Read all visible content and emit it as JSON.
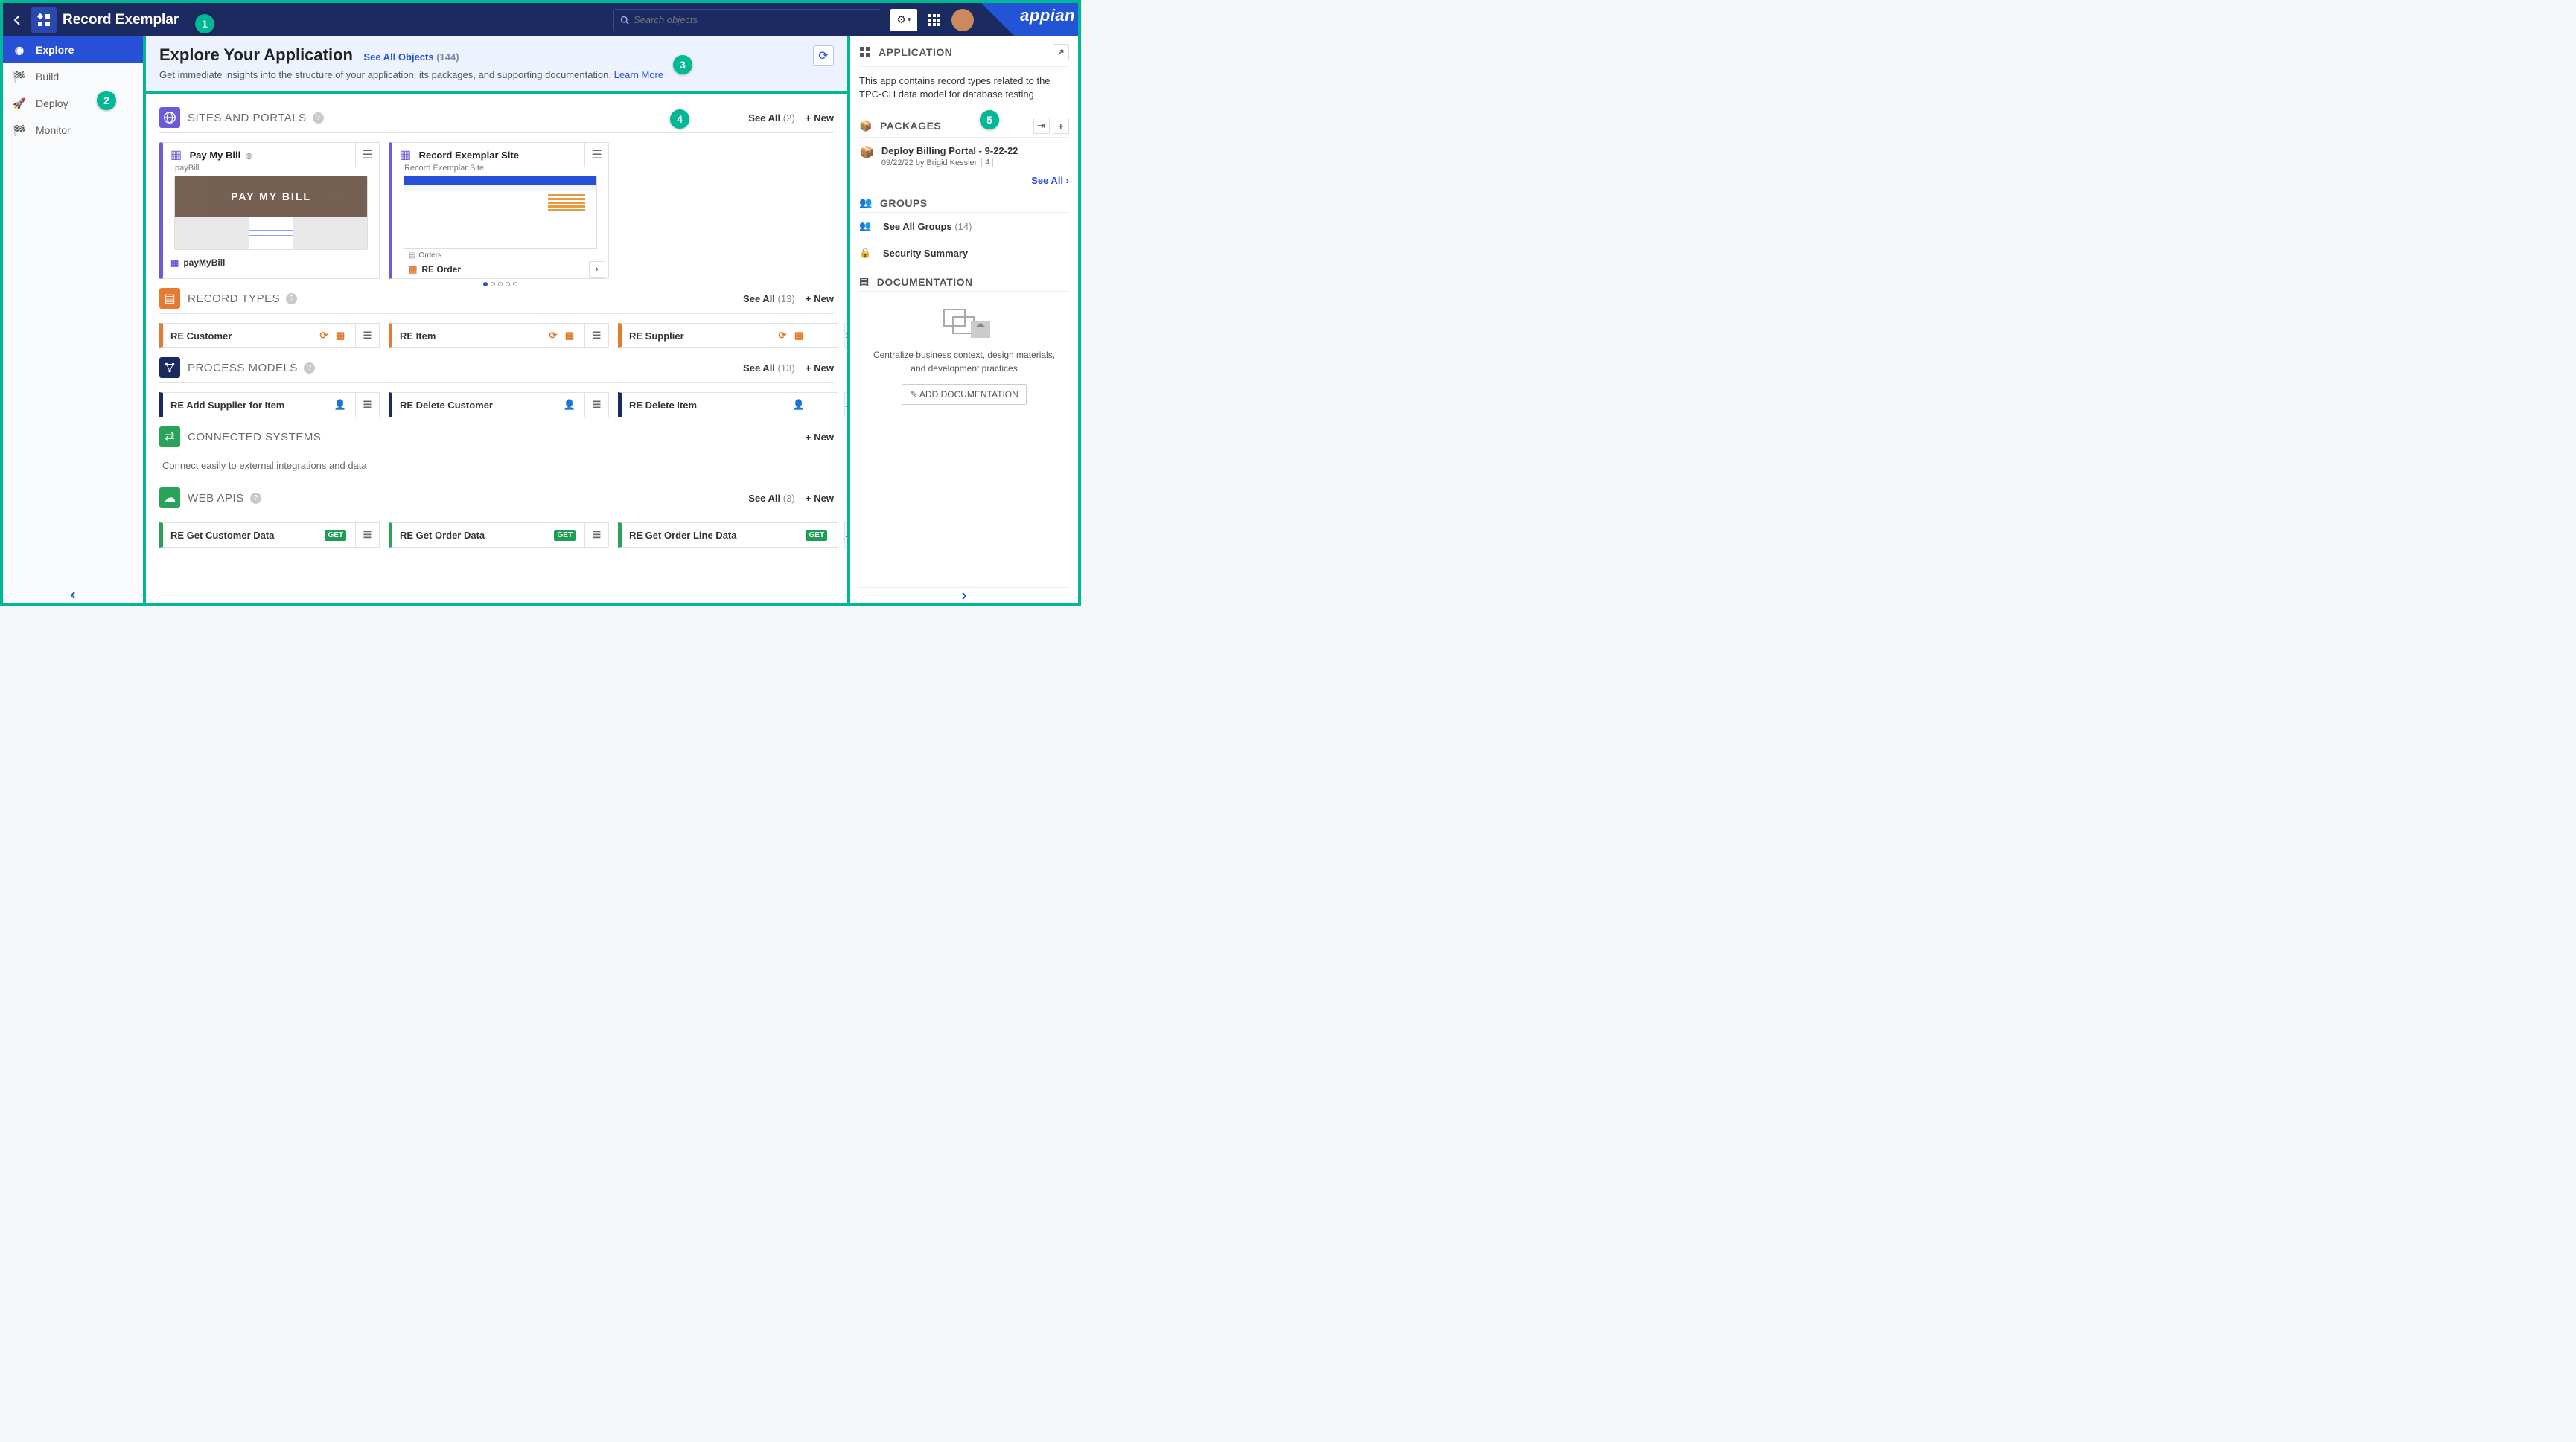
{
  "topbar": {
    "app_title": "Record Exemplar",
    "search_placeholder": "Search objects",
    "brand": "appian"
  },
  "sidebar": {
    "items": [
      {
        "label": "Explore"
      },
      {
        "label": "Build"
      },
      {
        "label": "Deploy"
      },
      {
        "label": "Monitor"
      }
    ]
  },
  "main": {
    "title": "Explore Your Application",
    "see_all_label": "See All Objects",
    "see_all_count": "(144)",
    "subtitle": "Get immediate insights into the structure of your application, its packages, and supporting documentation.",
    "learn_more": "Learn More"
  },
  "sections": {
    "sites": {
      "title": "SITES AND PORTALS",
      "see_all": "See All",
      "see_all_count": "(2)",
      "new_label": "New",
      "cards": [
        {
          "title": "Pay My Bill",
          "subtitle": "payBill",
          "hero": "PAY MY BILL",
          "page_name": "payMyBill"
        },
        {
          "title": "Record Exemplar Site",
          "subtitle": "Record Exemplar Site",
          "tab_group": "Orders",
          "tab_active": "RE Order"
        }
      ]
    },
    "record_types": {
      "title": "RECORD TYPES",
      "see_all": "See All",
      "see_all_count": "(13)",
      "new_label": "New",
      "items": [
        {
          "name": "RE Customer"
        },
        {
          "name": "RE Item"
        },
        {
          "name": "RE Supplier"
        }
      ]
    },
    "process_models": {
      "title": "PROCESS MODELS",
      "see_all": "See All",
      "see_all_count": "(13)",
      "new_label": "New",
      "items": [
        {
          "name": "RE Add Supplier for Item"
        },
        {
          "name": "RE Delete Customer"
        },
        {
          "name": "RE Delete Item"
        }
      ]
    },
    "connected_systems": {
      "title": "CONNECTED SYSTEMS",
      "new_label": "New",
      "empty_text": "Connect easily to external integrations and data"
    },
    "web_apis": {
      "title": "WEB APIS",
      "see_all": "See All",
      "see_all_count": "(3)",
      "new_label": "New",
      "items": [
        {
          "name": "RE Get Customer Data",
          "method": "GET"
        },
        {
          "name": "RE Get Order Data",
          "method": "GET"
        },
        {
          "name": "RE Get Order Line Data",
          "method": "GET"
        }
      ]
    }
  },
  "rightpanel": {
    "app_head": "APPLICATION",
    "description": "This app contains record types related to the TPC-CH data model for database testing",
    "packages_head": "PACKAGES",
    "package": {
      "title": "Deploy Billing Portal - 9-22-22",
      "meta": "09/22/22 by Brigid Kessler",
      "count": "4"
    },
    "see_all": "See All",
    "groups_head": "GROUPS",
    "groups_link": "See All Groups",
    "groups_count": "(14)",
    "security_link": "Security Summary",
    "docs_head": "DOCUMENTATION",
    "docs_text": "Centralize business context, design materials, and development practices",
    "docs_btn": "ADD DOCUMENTATION"
  },
  "callouts": [
    "1",
    "2",
    "3",
    "4",
    "5"
  ],
  "colors": {
    "purple": "#6a5bd6",
    "orange": "#e47b2e",
    "navy": "#1b2a60",
    "green": "#1f9d55",
    "teal": "#00b796",
    "greenbox": "#2aa35a"
  }
}
